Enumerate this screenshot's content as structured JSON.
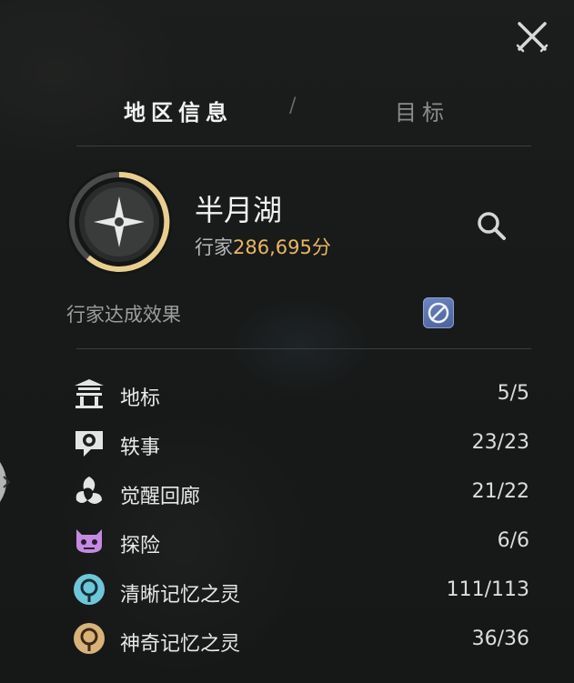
{
  "tabs": {
    "active": "地区信息",
    "separator": "/",
    "inactive": "目标"
  },
  "region": {
    "name": "半月湖",
    "score_label": "行家",
    "score_value": "286,695",
    "score_unit": "分"
  },
  "effect": {
    "label": "行家达成效果"
  },
  "categories": [
    {
      "label": "地标",
      "count": "5/5",
      "icon": "landmark-icon"
    },
    {
      "label": "轶事",
      "count": "23/23",
      "icon": "anecdote-icon"
    },
    {
      "label": "觉醒回廊",
      "count": "21/22",
      "icon": "awakening-corridor-icon"
    },
    {
      "label": "探险",
      "count": "6/6",
      "icon": "exploration-icon"
    },
    {
      "label": "清晰记忆之灵",
      "count": "111/113",
      "icon": "clear-memory-spirit-icon"
    },
    {
      "label": "神奇记忆之灵",
      "count": "36/36",
      "icon": "magic-memory-spirit-icon"
    }
  ],
  "colors": {
    "accent": "#e9b761",
    "exploration": "#c48be0",
    "clear_spirit": "#6fc6d8",
    "magic_spirit": "#d9b27a"
  }
}
